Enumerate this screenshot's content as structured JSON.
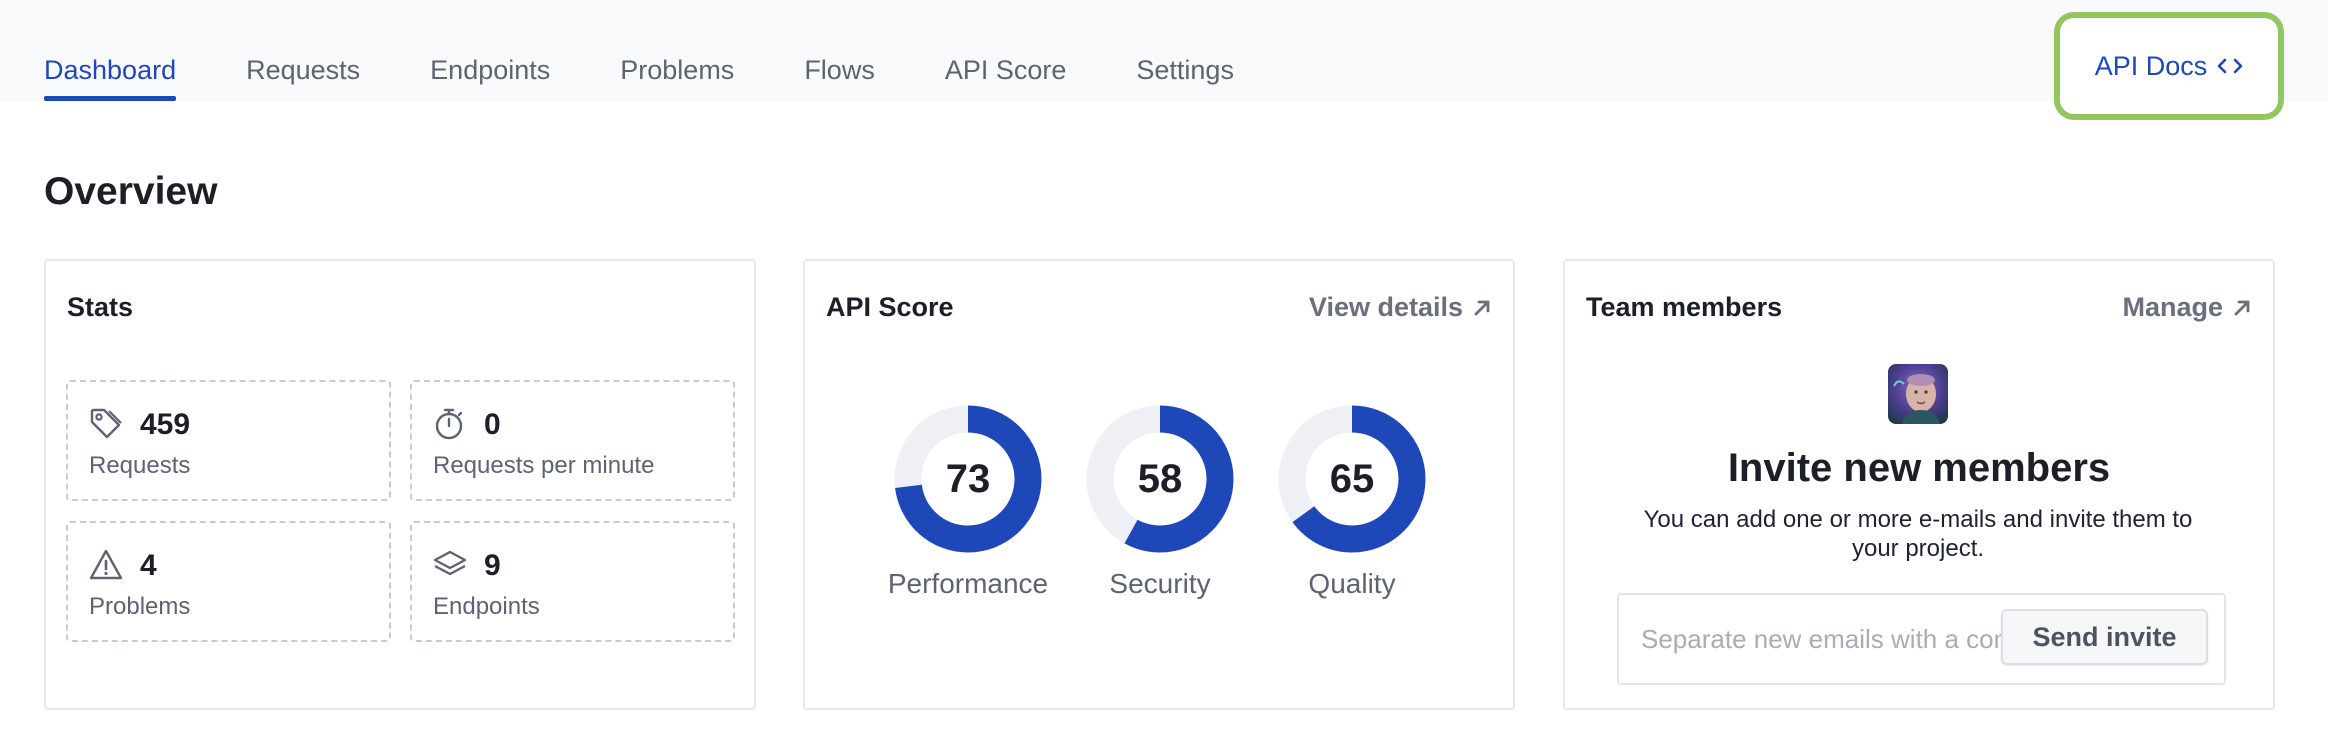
{
  "nav": {
    "tabs": [
      {
        "label": "Dashboard",
        "active": true
      },
      {
        "label": "Requests",
        "active": false
      },
      {
        "label": "Endpoints",
        "active": false
      },
      {
        "label": "Problems",
        "active": false
      },
      {
        "label": "Flows",
        "active": false
      },
      {
        "label": "API Score",
        "active": false
      },
      {
        "label": "Settings",
        "active": false
      }
    ],
    "api_docs": {
      "label": "API Docs",
      "icon": "code-brackets-icon",
      "highlight_color": "#93c660"
    }
  },
  "page": {
    "title": "Overview"
  },
  "stats": {
    "title": "Stats",
    "items": [
      {
        "value": "459",
        "label": "Requests",
        "icon": "tag-icon"
      },
      {
        "value": "0",
        "label": "Requests per minute",
        "icon": "stopwatch-icon"
      },
      {
        "value": "4",
        "label": "Problems",
        "icon": "warning-icon"
      },
      {
        "value": "9",
        "label": "Endpoints",
        "icon": "layers-icon"
      }
    ]
  },
  "api_score": {
    "title": "API Score",
    "link": "View details",
    "gauges": [
      {
        "value": 73,
        "label": "Performance"
      },
      {
        "value": 58,
        "label": "Security"
      },
      {
        "value": 65,
        "label": "Quality"
      }
    ],
    "colors": {
      "arc": "#1e48b8",
      "track": "#eef0f5"
    }
  },
  "team": {
    "title": "Team members",
    "link": "Manage",
    "avatar": "user-avatar",
    "invite_title": "Invite new members",
    "invite_text": "You can add one or more e-mails and invite them to your project.",
    "input_placeholder": "Separate new emails with a comma",
    "send_label": "Send invite"
  },
  "colors": {
    "accent": "#1e48b8",
    "muted_text": "#5d6371",
    "nav_bg": "#f8f9fb"
  }
}
